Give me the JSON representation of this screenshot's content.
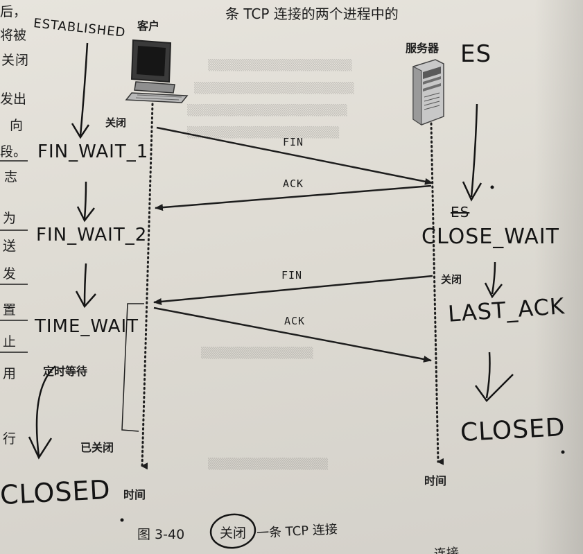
{
  "page": {
    "top_text": "条 TCP 连接的两个进程中的",
    "left_margin_chars": [
      "后，",
      "将被",
      "关",
      "闭",
      "发出",
      "向",
      "段。",
      "志",
      "为",
      "送",
      "发",
      "置",
      "止",
      "用",
      "行"
    ],
    "bottom_partial": "连接"
  },
  "diagram": {
    "client_label": "客户",
    "server_label": "服务器",
    "client_close_label": "关闭",
    "server_close_label": "关闭",
    "client_time_label": "时间",
    "server_time_label": "时间",
    "timed_wait_label": "定时等待",
    "client_closed_label": "已关闭",
    "messages": [
      {
        "label": "FIN",
        "direction": "client-to-server"
      },
      {
        "label": "ACK",
        "direction": "server-to-client"
      },
      {
        "label": "FIN",
        "direction": "server-to-client"
      },
      {
        "label": "ACK",
        "direction": "client-to-server"
      }
    ],
    "caption_prefix": "图 3-40",
    "caption_circled": "关闭",
    "caption_suffix": "一条 TCP 连接"
  },
  "annotations": {
    "client_states": [
      "ESTABLISHED",
      "FIN_WAIT_1",
      "FIN_WAIT_2",
      "TIME_WAIT",
      "CLOSED"
    ],
    "server_states": [
      "ES",
      "CLOSE_WAIT",
      "LAST_ACK",
      "CLOSED"
    ],
    "server_struck": "ES"
  },
  "colors": {
    "ink": "#1d1d1d",
    "pen": "#141414",
    "paper": "#e2dfd8"
  }
}
